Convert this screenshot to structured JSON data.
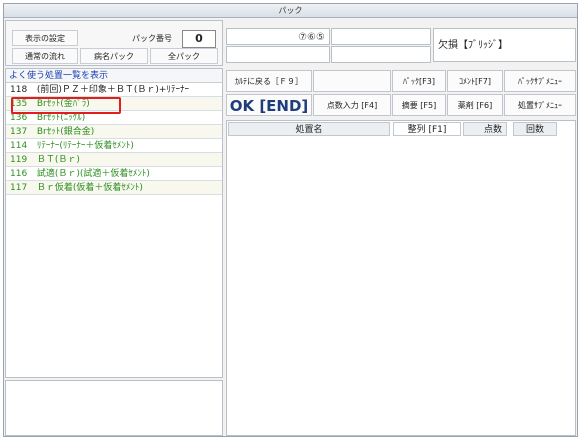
{
  "window": {
    "title": "パック"
  },
  "controls": {
    "display_settings": "表示の設定",
    "pack_number_label": "パック番号",
    "pack_number": "0",
    "normal_flow": "通常の流れ",
    "disease_pack": "病名パック",
    "all_pack": "全パック"
  },
  "shortcut_list": {
    "header": "よく使う処置一覧を表示",
    "items": [
      {
        "code": "118",
        "label": "(前回)ＰＺ＋印象＋ＢＴ(Ｂｒ)+ﾘﾃｰﾅｰ"
      },
      {
        "code": "135",
        "label": "Brｾｯﾄ(金ﾊﾟﾗ)"
      },
      {
        "code": "136",
        "label": "Brｾｯﾄ(ﾆｯｹﾙ)"
      },
      {
        "code": "137",
        "label": "Brｾｯﾄ(銀合金)"
      },
      {
        "code": "114",
        "label": "ﾘﾃｰﾅｰ(ﾘﾃｰﾅｰ＋仮着ｾﾒﾝﾄ)"
      },
      {
        "code": "119",
        "label": "ＢＴ(Ｂｒ)"
      },
      {
        "code": "116",
        "label": "試適(Ｂｒ)(試適＋仮着ｾﾒﾝﾄ)"
      },
      {
        "code": "117",
        "label": "Ｂｒ仮着(仮着＋仮着ｾﾒﾝﾄ)"
      }
    ]
  },
  "info": {
    "circled_numbers": "⑦⑥⑤",
    "missing_teeth": "欠損【ﾌﾞﾘｯｼﾞ】"
  },
  "buttons": {
    "back_to_chart": "ｶﾙﾃに戻る［Ｆ９］",
    "pack_f3": "ﾊﾟｯｸ[F3]",
    "comment_f7": "ｺﾒﾝﾄ[F7]",
    "pack_sub_menu": "ﾊﾟｯｸｻﾌﾞﾒﾆｭｰ",
    "ok_end": "OK [END]",
    "points_input": "点数入力 [F4]",
    "summary_f5": "摘要 [F5]",
    "drug_f6": "薬剤 [F6]",
    "treatment_sub_menu": "処置ｻﾌﾞﾒﾆｭｰ"
  },
  "table": {
    "columns": {
      "name": "処置名",
      "sort": "整列 [F1]",
      "points": "点数",
      "count": "回数"
    }
  }
}
